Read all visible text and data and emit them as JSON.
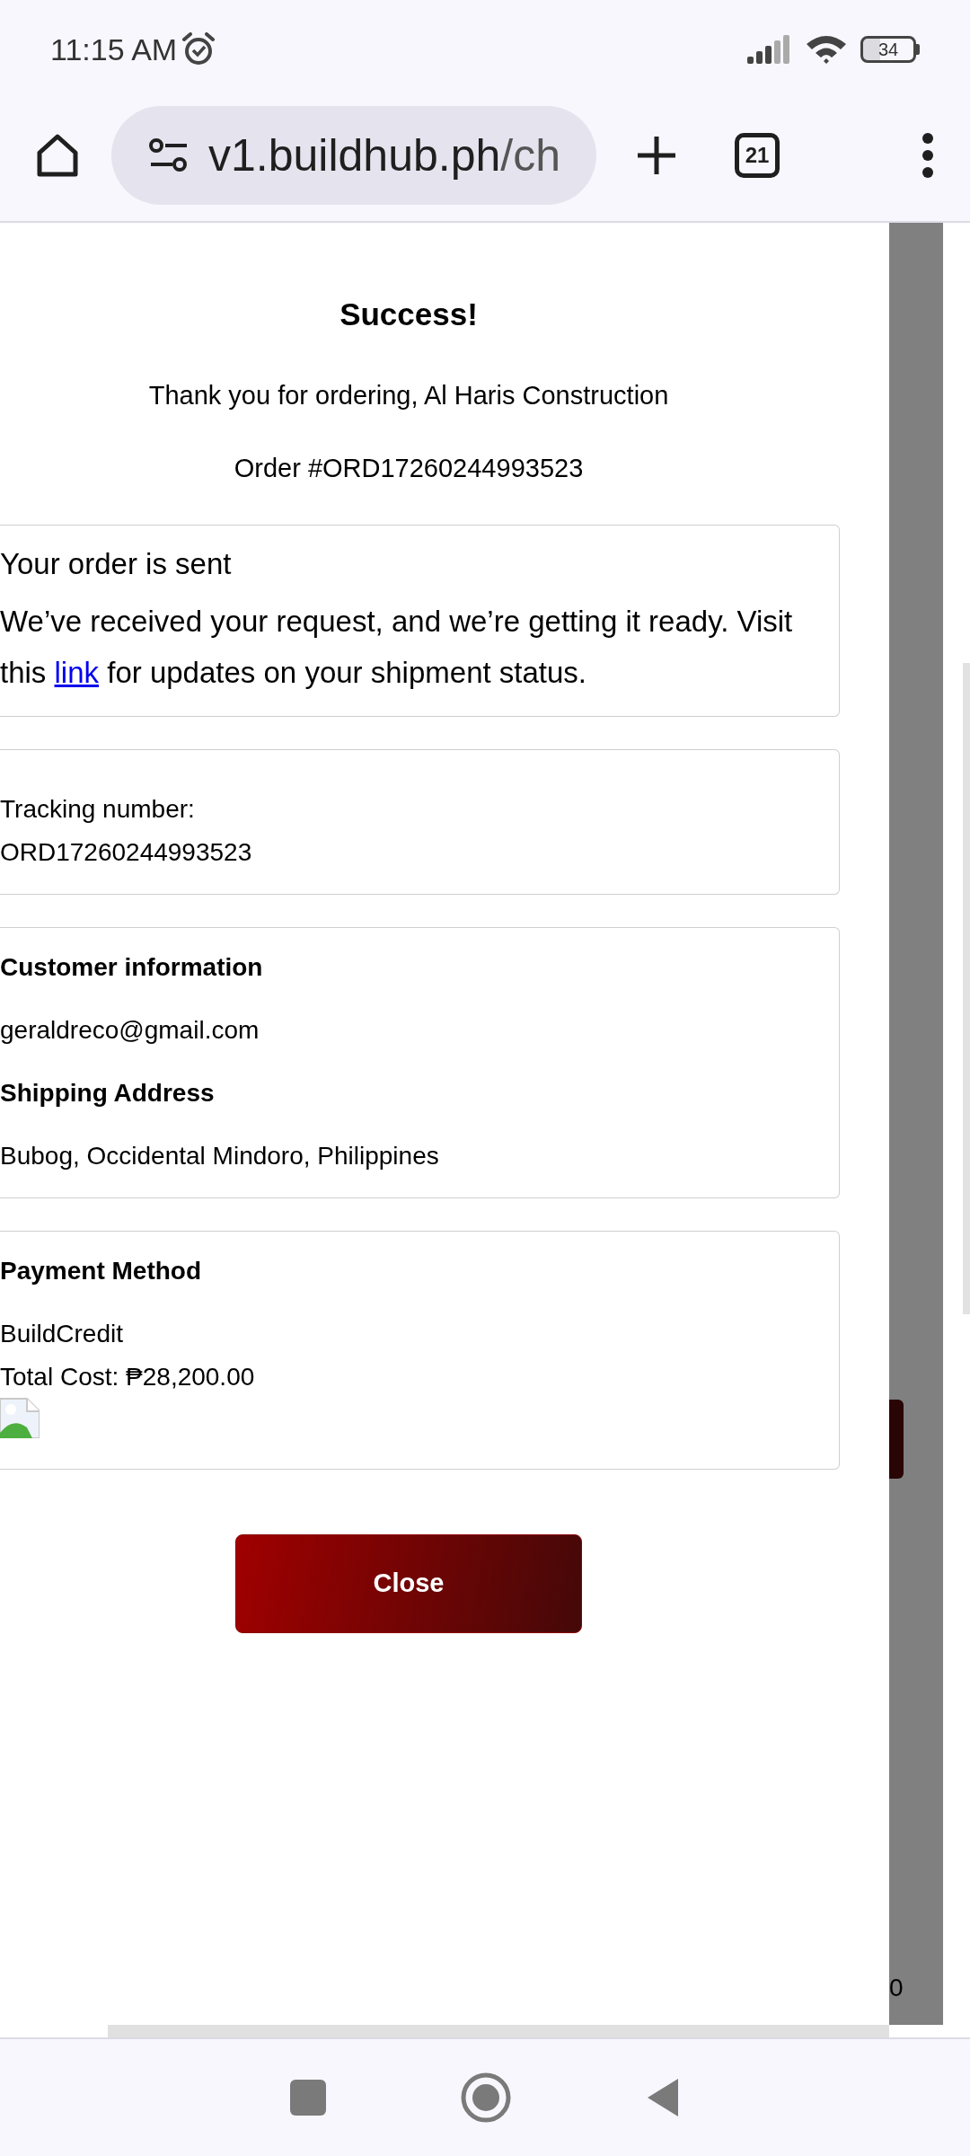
{
  "status_bar": {
    "time": "11:15 AM",
    "battery": "34"
  },
  "browser": {
    "url_host": "v1.buildhub.ph",
    "url_path": "/ch",
    "tab_count": "21"
  },
  "modal": {
    "title": "Success!",
    "thanks": "Thank you for ordering, Al Haris Construction",
    "order_number": "Order #ORD17260244993523",
    "cards": [
      {
        "kind": "message",
        "heading": "Your order is sent",
        "text_before": "We’ve received your request, and we’re getting it ready. Visit this",
        "link": "link",
        "text_after": "for updates on your shipment status."
      },
      {
        "kind": "tracking",
        "label": "Tracking number:",
        "value": "ORD17260244993523"
      },
      {
        "kind": "info",
        "sections": [
          {
            "heading": "Customer information",
            "value": "geraldreco@gmail.com"
          },
          {
            "heading": "Shipping Address",
            "value": "Bubog, Occidental Mindoro, Philippines"
          }
        ]
      },
      {
        "kind": "payment",
        "heading": "Payment Method",
        "method": "BuildCredit",
        "total": "Total Cost: ₱28,200.00",
        "broken_image": true
      }
    ],
    "close_button": "Close"
  },
  "background_fragment": "0"
}
